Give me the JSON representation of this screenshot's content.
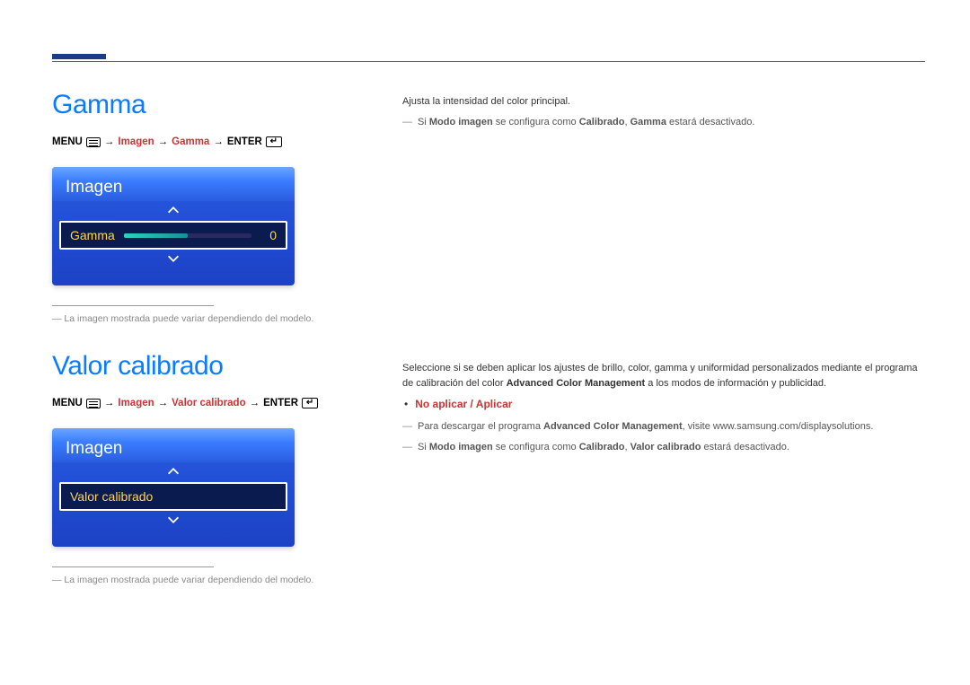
{
  "section1": {
    "title": "Gamma",
    "breadcrumb": {
      "menu": "MENU",
      "p1": "Imagen",
      "p2": "Gamma",
      "enter": "ENTER"
    },
    "osd": {
      "header": "Imagen",
      "row_label": "Gamma",
      "row_value": "0"
    },
    "footnote": "― La imagen mostrada puede variar dependiendo del modelo."
  },
  "section2": {
    "title": "Valor calibrado",
    "breadcrumb": {
      "menu": "MENU",
      "p1": "Imagen",
      "p2": "Valor calibrado",
      "enter": "ENTER"
    },
    "osd": {
      "header": "Imagen",
      "row_label": "Valor calibrado"
    },
    "footnote": "― La imagen mostrada puede variar dependiendo del modelo."
  },
  "right1": {
    "l1": "Ajusta la intensidad del color principal.",
    "note_prefix": "Si ",
    "note_b1": "Modo imagen",
    "note_mid": " se configura como ",
    "note_b2": "Calibrado",
    "note_sep": ", ",
    "note_b3": "Gamma",
    "note_tail": " estará desactivado."
  },
  "right2": {
    "l1a": "Seleccione si se deben aplicar los ajustes de brillo, color, gamma y uniformidad personalizados mediante el programa de calibración del color ",
    "l1b": "Advanced Color Management",
    "l1c": " a los modos de información y publicidad.",
    "bullet": "No aplicar / Aplicar",
    "note1a": "Para descargar el programa ",
    "note1b": "Advanced Color Management",
    "note1c": ", visite www.samsung.com/displaysolutions.",
    "note2_prefix": "Si ",
    "note2_b1": "Modo imagen",
    "note2_mid": " se configura como ",
    "note2_b2": "Calibrado",
    "note2_sep": ", ",
    "note2_b3": "Valor calibrado",
    "note2_tail": " estará desactivado."
  }
}
